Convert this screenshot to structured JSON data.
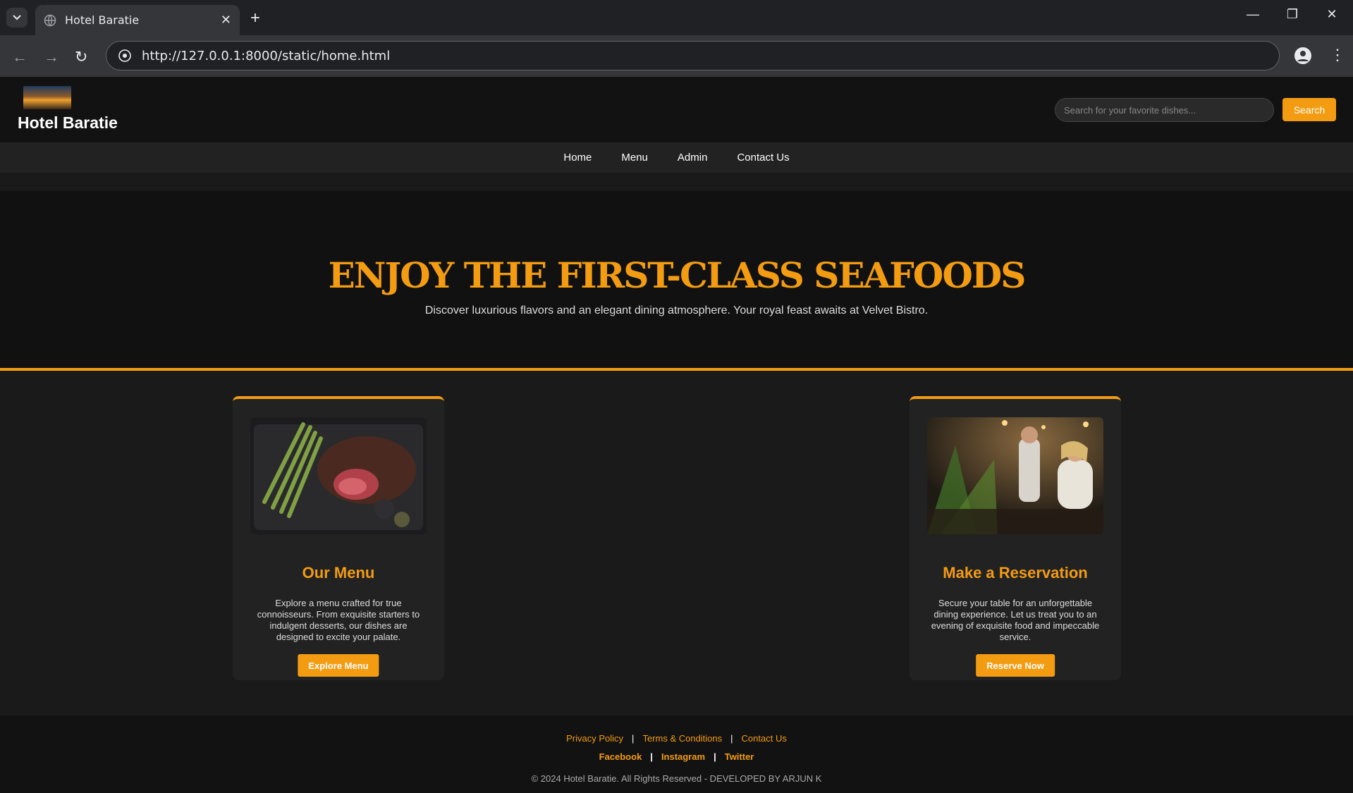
{
  "browser": {
    "tab_title": "Hotel Baratie",
    "url": "http://127.0.0.1:8000/static/home.html"
  },
  "header": {
    "site_title": "Hotel Baratie",
    "search_placeholder": "Search for your favorite dishes...",
    "search_button": "Search"
  },
  "nav": {
    "items": [
      "Home",
      "Menu",
      "Admin",
      "Contact Us"
    ]
  },
  "hero": {
    "title": "ENJOY THE FIRST-CLASS SEAFOODS",
    "subtitle": "Discover luxurious flavors and an elegant dining atmosphere. Your royal feast awaits at Velvet Bistro."
  },
  "cards": [
    {
      "title": "Our Menu",
      "text": "Explore a menu crafted for true connoisseurs. From exquisite starters to indulgent desserts, our dishes are designed to excite your palate.",
      "button": "Explore Menu"
    },
    {
      "title": "Make a Reservation",
      "text": "Secure your table for an unforgettable dining experience. Let us treat you to an evening of exquisite food and impeccable service.",
      "button": "Reserve Now"
    }
  ],
  "footer": {
    "links": [
      "Privacy Policy",
      "Terms & Conditions",
      "Contact Us"
    ],
    "social": [
      "Facebook",
      "Instagram",
      "Twitter"
    ],
    "copyright": "© 2024 Hotel Baratie. All Rights Reserved - DEVELOPED BY ARJUN K"
  },
  "colors": {
    "accent": "#f39c12",
    "background": "#1a1a1a"
  }
}
